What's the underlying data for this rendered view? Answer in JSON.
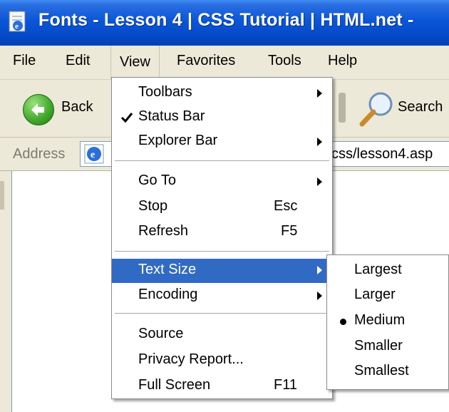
{
  "window": {
    "title": "Fonts - Lesson 4 | CSS Tutorial | HTML.net -"
  },
  "menubar": {
    "items": [
      "File",
      "Edit",
      "View",
      "Favorites",
      "Tools",
      "Help"
    ],
    "active": "View"
  },
  "toolbar": {
    "back_label": "Back",
    "search_label": "Search"
  },
  "address": {
    "label": "Address",
    "url_visible": "css/lesson4.asp"
  },
  "view_menu": {
    "items": [
      {
        "label": "Toolbars",
        "submenu": true
      },
      {
        "label": "Status Bar",
        "checked": true
      },
      {
        "label": "Explorer Bar",
        "submenu": true
      },
      {
        "label": "Go To",
        "submenu": true
      },
      {
        "label": "Stop",
        "shortcut": "Esc"
      },
      {
        "label": "Refresh",
        "shortcut": "F5"
      },
      {
        "label": "Text Size",
        "submenu": true,
        "highlighted": true
      },
      {
        "label": "Encoding",
        "submenu": true
      },
      {
        "label": "Source"
      },
      {
        "label": "Privacy Report..."
      },
      {
        "label": "Full Screen",
        "shortcut": "F11"
      }
    ]
  },
  "text_size_menu": {
    "items": [
      "Largest",
      "Larger",
      "Medium",
      "Smaller",
      "Smallest"
    ],
    "selected": "Medium"
  },
  "colors": {
    "titlebar": "#0a56d8",
    "highlight": "#316ac5",
    "menubar": "#ece9d8"
  },
  "icons": [
    "ie-page-icon",
    "back-arrow-icon",
    "search-magnifier-icon",
    "ie-address-icon",
    "checkmark-icon",
    "submenu-arrow-icon",
    "radio-dot-icon"
  ]
}
